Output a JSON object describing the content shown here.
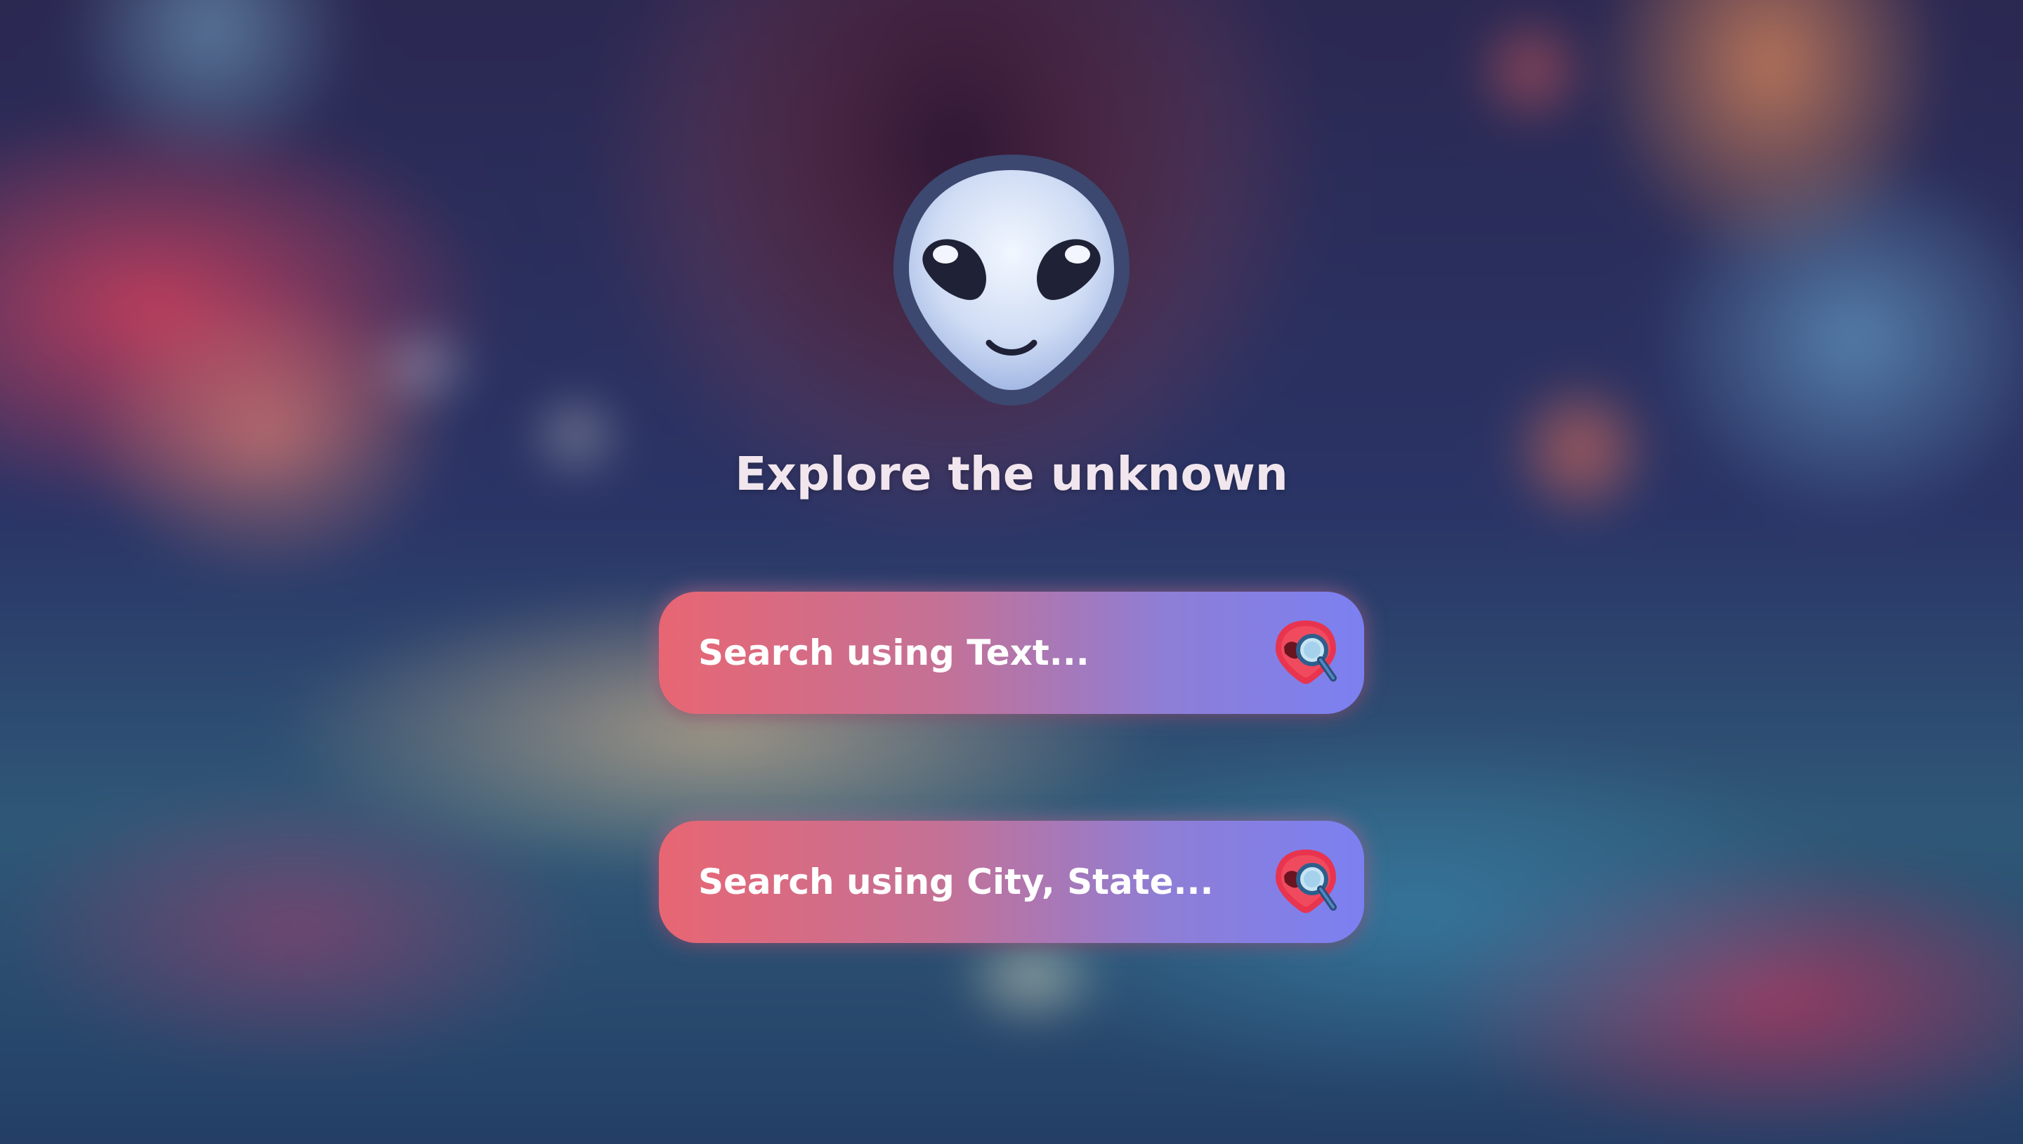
{
  "hero": {
    "logo_icon": "alien-icon",
    "title": "Explore the unknown"
  },
  "search_text": {
    "placeholder": "Search using Text...",
    "button_icon": "alien-search-icon"
  },
  "search_location": {
    "placeholder": "Search using City, State...",
    "button_icon": "alien-search-icon"
  },
  "colors": {
    "gradient_start": "#e86673",
    "gradient_end": "#7b80f1",
    "title": "#f2e6ee",
    "logo_outline": "#3e4a72",
    "logo_face": "#cfe0f7"
  }
}
